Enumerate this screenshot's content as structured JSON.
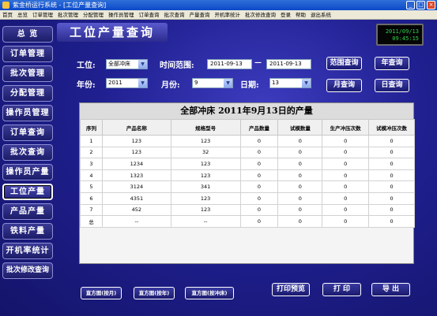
{
  "window": {
    "title": "紫金桥运行系统 - [工位产量查询]"
  },
  "menu": [
    "首页",
    "总览",
    "订单管理",
    "批次管理",
    "分配管理",
    "操作员管理",
    "订单查询",
    "批次查询",
    "产量查询",
    "开机率统计",
    "批次修改查询",
    "登录",
    "帮助",
    "退出系统"
  ],
  "sidebar": {
    "items": [
      {
        "label": "总 览"
      },
      {
        "label": "订单管理"
      },
      {
        "label": "批次管理"
      },
      {
        "label": "分配管理"
      },
      {
        "label": "操作员管理"
      },
      {
        "label": "订单查询"
      },
      {
        "label": "批次查询"
      },
      {
        "label": "操作员产量"
      },
      {
        "label": "工位产量"
      },
      {
        "label": "产品产量"
      },
      {
        "label": "铁料产量"
      },
      {
        "label": "开机率统计"
      },
      {
        "label": "批次修改查询"
      }
    ]
  },
  "page_title": "工位产量查询",
  "clock": {
    "date": "2011/09/13",
    "time": "09:45:15"
  },
  "filters": {
    "station_label": "工位:",
    "station_value": "全部冲床",
    "range_label": "时间范围:",
    "range_start": "2011-09-13",
    "range_sep": "—",
    "range_end": "2011-09-13",
    "year_label": "年份:",
    "year_value": "2011",
    "month_label": "月份:",
    "month_value": "9",
    "day_label": "日期:",
    "day_value": "13"
  },
  "query_buttons": {
    "range": "范围查询",
    "year": "年查询",
    "month": "月查询",
    "day": "日查询"
  },
  "table": {
    "caption": "全部冲床 2011年9月13日的产量",
    "headers": [
      "序列",
      "产品名称",
      "规格型号",
      "产品数量",
      "试模数量",
      "生产冲压次数",
      "试模冲压次数"
    ],
    "rows": [
      [
        "1",
        "123",
        "123",
        "0",
        "0",
        "0",
        "0"
      ],
      [
        "2",
        "123",
        "32",
        "0",
        "0",
        "0",
        "0"
      ],
      [
        "3",
        "1234",
        "123",
        "0",
        "0",
        "0",
        "0"
      ],
      [
        "4",
        "1323",
        "123",
        "0",
        "0",
        "0",
        "0"
      ],
      [
        "5",
        "3124",
        "341",
        "0",
        "0",
        "0",
        "0"
      ],
      [
        "6",
        "4351",
        "123",
        "0",
        "0",
        "0",
        "0"
      ],
      [
        "7",
        "452",
        "123",
        "0",
        "0",
        "0",
        "0"
      ],
      [
        "总",
        "--",
        "--",
        "0",
        "0",
        "0",
        "0"
      ]
    ]
  },
  "bottom_buttons": {
    "hist_month": "直方图(按月)",
    "hist_year": "直方图(按年)",
    "hist_press": "直方图(按冲床)",
    "print_preview": "打印预览",
    "print": "打 印",
    "export": "导 出"
  },
  "colors": {
    "background": "#1f1f8f",
    "clock_text": "#2fd14a",
    "titlebar": "#0b48c8"
  }
}
